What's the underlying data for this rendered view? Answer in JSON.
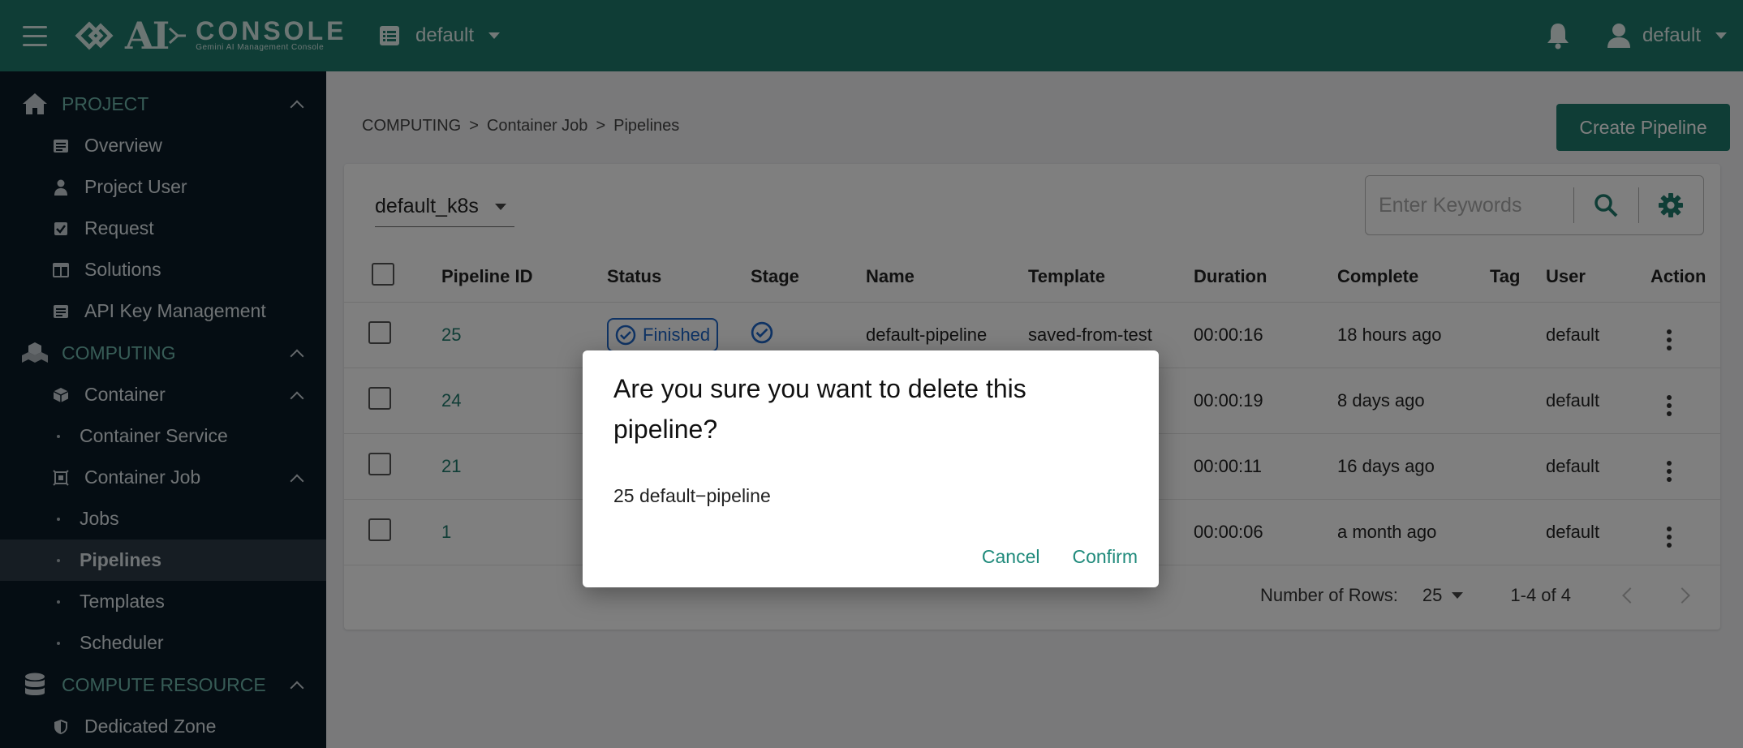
{
  "header": {
    "logo_ai": "AI",
    "logo_console": "CONSOLE",
    "logo_tagline": "Gemini AI Management Console",
    "project": "default",
    "user": "default"
  },
  "sidebar": {
    "project_group": "PROJECT",
    "project_items": [
      "Overview",
      "Project User",
      "Request",
      "Solutions",
      "API Key Management"
    ],
    "computing_group": "COMPUTING",
    "container": "Container",
    "container_service": "Container Service",
    "container_job": "Container Job",
    "jobs": "Jobs",
    "pipelines": "Pipelines",
    "templates": "Templates",
    "scheduler": "Scheduler",
    "compute_resource_group": "COMPUTE RESOURCE",
    "dedicated_zone": "Dedicated Zone"
  },
  "breadcrumb": [
    "COMPUTING",
    ">",
    "Container Job",
    ">",
    "Pipelines"
  ],
  "create_button": "Create Pipeline",
  "cluster": "default_k8s",
  "search": {
    "placeholder": "Enter Keywords"
  },
  "table": {
    "headers": [
      "Pipeline ID",
      "Status",
      "Stage",
      "Name",
      "Template",
      "Duration",
      "Complete",
      "Tag",
      "User",
      "Action"
    ],
    "rows": [
      {
        "id": "25",
        "status": "Finished",
        "name": "default-pipeline",
        "template": "saved-from-test",
        "duration": "00:00:16",
        "complete": "18 hours ago",
        "user": "default"
      },
      {
        "id": "24",
        "duration": "00:00:19",
        "complete": "8 days ago",
        "user": "default"
      },
      {
        "id": "21",
        "duration": "00:00:11",
        "complete": "16 days ago",
        "user": "default"
      },
      {
        "id": "1",
        "duration": "00:00:06",
        "complete": "a month ago",
        "user": "default"
      }
    ]
  },
  "pagination": {
    "rows_label": "Number of Rows:",
    "rows_value": "25",
    "range": "1-4 of 4"
  },
  "dialog": {
    "title": "Are you sure you want to delete this pipeline?",
    "message": "25 default−pipeline",
    "cancel": "Cancel",
    "confirm": "Confirm"
  },
  "colors": {
    "brand": "#1f7a6d",
    "sidebar_bg": "#0b1a27",
    "status_blue": "#1f67c9",
    "link_teal": "#1f8a7b"
  }
}
